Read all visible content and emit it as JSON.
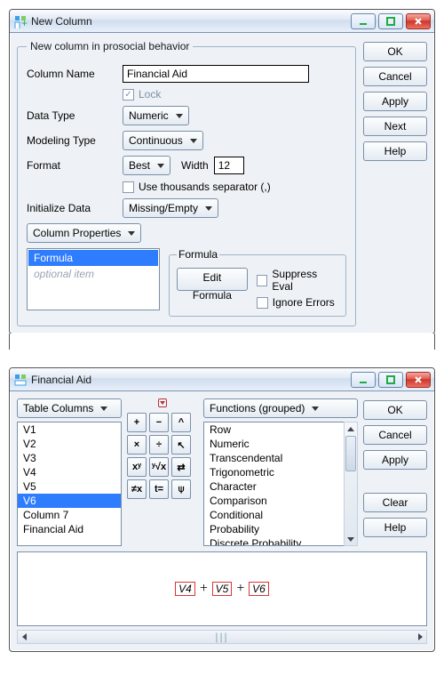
{
  "win1": {
    "title": "New Column",
    "group_legend": "New column in prosocial behavior",
    "labels": {
      "column_name": "Column Name",
      "data_type": "Data Type",
      "modeling_type": "Modeling Type",
      "format": "Format",
      "width_label": "Width",
      "initialize": "Initialize Data",
      "lock": "Lock",
      "thousands": "Use thousands separator (,)"
    },
    "values": {
      "column_name": "Financial Aid",
      "data_type": "Numeric",
      "modeling_type": "Continuous",
      "format": "Best",
      "width": "12",
      "initialize": "Missing/Empty",
      "column_properties": "Column Properties"
    },
    "props": {
      "items": [
        "Formula",
        "optional item"
      ],
      "selected": 0
    },
    "formula": {
      "legend": "Formula",
      "edit_btn": "Edit Formula",
      "suppress": "Suppress Eval",
      "ignore": "Ignore Errors"
    },
    "buttons": [
      "OK",
      "Cancel",
      "Apply",
      "Next",
      "Help"
    ]
  },
  "win2": {
    "title": "Financial Aid",
    "table_columns_btn": "Table Columns",
    "columns": [
      "V1",
      "V2",
      "V3",
      "V4",
      "V5",
      "V6",
      "Column 7",
      "Financial Aid"
    ],
    "columns_selected": 5,
    "funcs_btn": "Functions (grouped)",
    "funcs": [
      "Row",
      "Numeric",
      "Transcendental",
      "Trigonometric",
      "Character",
      "Comparison",
      "Conditional",
      "Probability",
      "Discrete Probability"
    ],
    "keypad": [
      "+",
      "−",
      "^",
      "×",
      "÷",
      "↖",
      "xʸ",
      "ʸ√x",
      "⇄",
      "≠x",
      "t=",
      "⍦"
    ],
    "expression_parts": [
      "V4",
      "+",
      "V5",
      "+",
      "V6"
    ],
    "buttons": [
      "OK",
      "Cancel",
      "Apply",
      "Clear",
      "Help"
    ]
  }
}
